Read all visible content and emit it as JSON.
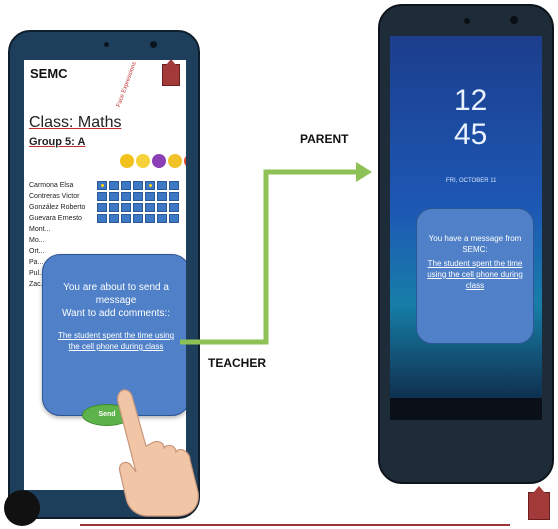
{
  "left_phone": {
    "brand": "SEMC",
    "class_label": "Class: Maths",
    "group_label": "Group 5: A",
    "vertical_label": "Face Expressions",
    "emojis": [
      "nerd-face-icon",
      "smiling-face-icon",
      "devil-face-icon",
      "sad-face-icon",
      "angry-face-icon"
    ],
    "students": [
      "Carmona Elsa",
      "Contreras Victor",
      "González Roberto",
      "Guevara Ernesto",
      "Mont...",
      "Mo...",
      "Ort...",
      "Pa...",
      "Pul...",
      "Zac..."
    ],
    "popup": {
      "line1": "You are about to send a message",
      "line2": "Want to add comments::",
      "comment": "The student spent the time using the cell phone during class"
    },
    "send_label": "Send"
  },
  "labels": {
    "parent": "PARENT",
    "teacher": "TEACHER"
  },
  "right_phone": {
    "clock_hours": "12",
    "clock_minutes": "45",
    "date": "FRI, OCTOBER 11",
    "message_intro": "You have a message from SEMC:",
    "message_body": "The student spent the time using the cell phone during class"
  },
  "colors": {
    "popup": "#4f80c8",
    "send": "#5db34a",
    "arrow": "#8dc156",
    "accent_red": "#9e3535"
  }
}
